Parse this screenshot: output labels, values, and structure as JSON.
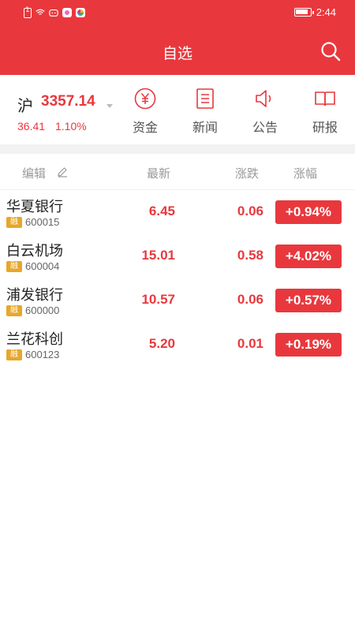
{
  "status_bar": {
    "time": "2:44"
  },
  "header": {
    "title": "自选"
  },
  "market_index": {
    "name": "沪",
    "value": "3357.14",
    "change": "36.41",
    "change_pct": "1.10%"
  },
  "quick_actions": [
    {
      "label": "资金",
      "icon": "yuan-icon"
    },
    {
      "label": "新闻",
      "icon": "news-doc-icon"
    },
    {
      "label": "公告",
      "icon": "speaker-icon"
    },
    {
      "label": "研报",
      "icon": "book-icon"
    }
  ],
  "columns": {
    "edit": "编辑",
    "latest": "最新",
    "change": "涨跌",
    "change_pct": "涨幅"
  },
  "stocks": [
    {
      "name": "华夏银行",
      "tag": "融",
      "code": "600015",
      "price": "6.45",
      "change": "0.06",
      "change_pct": "+0.94%"
    },
    {
      "name": "白云机场",
      "tag": "融",
      "code": "600004",
      "price": "15.01",
      "change": "0.58",
      "change_pct": "+4.02%"
    },
    {
      "name": "浦发银行",
      "tag": "融",
      "code": "600000",
      "price": "10.57",
      "change": "0.06",
      "change_pct": "+0.57%"
    },
    {
      "name": "兰花科创",
      "tag": "融",
      "code": "600123",
      "price": "5.20",
      "change": "0.01",
      "change_pct": "+0.19%"
    }
  ],
  "colors": {
    "brand_red": "#e8383d",
    "tag_orange": "#e7a72b"
  }
}
